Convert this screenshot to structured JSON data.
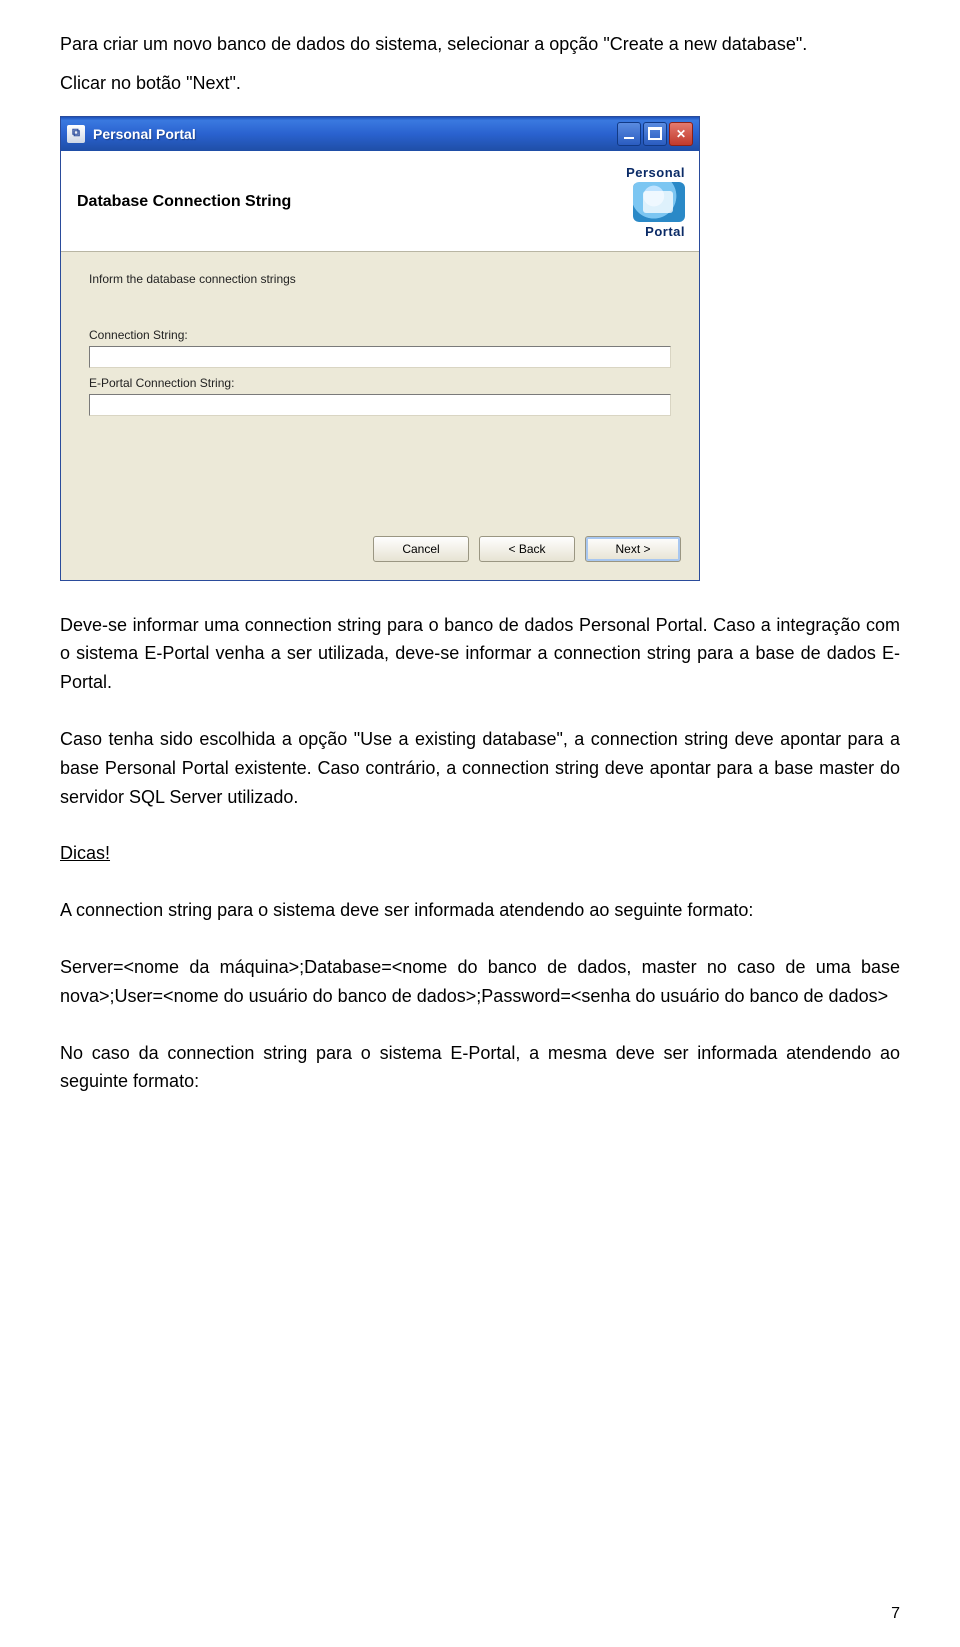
{
  "intro": {
    "p1": "Para criar um novo banco de dados do sistema, selecionar a opção \"Create a new database\".",
    "p2": "Clicar no botão \"Next\"."
  },
  "dialog": {
    "title": "Personal Portal",
    "banner_title": "Database Connection String",
    "logo_top": "Personal",
    "logo_bottom": "Portal",
    "instruction": "Inform the database connection strings",
    "field1_label": "Connection String:",
    "field1_value": "",
    "field2_label": "E-Portal Connection String:",
    "field2_value": "",
    "cancel": "Cancel",
    "back": "< Back",
    "next": "Next >"
  },
  "body": {
    "p3": "Deve-se informar uma connection string para o banco de dados Personal Portal. Caso a integração com o sistema E-Portal venha a ser utilizada, deve-se informar a connection string para a base de dados E-Portal.",
    "p4": "Caso tenha sido escolhida a opção  \"Use a existing database\", a connection string deve apontar para a base Personal Portal existente. Caso contrário, a connection string deve apontar para a base master do servidor SQL Server utilizado.",
    "dicas": "Dicas!",
    "p5": "A connection string para o sistema deve ser informada atendendo ao seguinte formato:",
    "p6": "Server=<nome da máquina>;Database=<nome do banco de dados, master no caso de uma base nova>;User=<nome do usuário do banco de dados>;Password=<senha do usuário do banco de dados>",
    "p7": "No caso da connection string para o sistema E-Portal, a mesma deve ser informada atendendo ao seguinte formato:"
  },
  "page_number": "7"
}
